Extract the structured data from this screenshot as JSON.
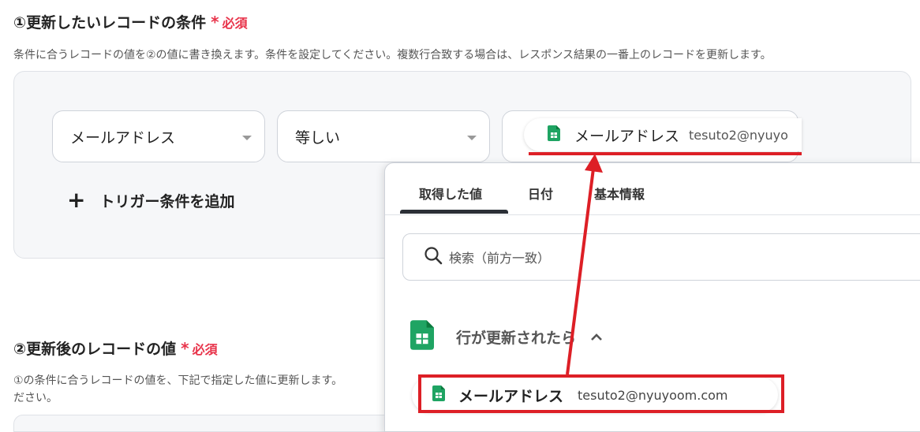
{
  "section1": {
    "title": "①更新したいレコードの条件",
    "required_label": "必須",
    "description": "条件に合うレコードの値を②の値に書き換えます。条件を設定してください。複数行合致する場合は、レスポンス結果の一番上のレコードを更新します。",
    "field_select": "メールアドレス",
    "operator_select": "等しい",
    "value_chip": {
      "label": "メールアドレス",
      "value": "tesuto2@nyuyo"
    },
    "add_condition": "トリガー条件を追加"
  },
  "section2": {
    "title": "②更新後のレコードの値",
    "required_label": "必須",
    "description_line1": "①の条件に合うレコードの値を、下記で指定した値に更新します。",
    "description_line2": "ださい。"
  },
  "dropdown": {
    "tabs": [
      "取得した値",
      "日付",
      "基本情報"
    ],
    "active_tab_index": 0,
    "search_placeholder": "検索（前方一致）",
    "group_title": "行が更新されたら",
    "item": {
      "label": "メールアドレス",
      "value": "tesuto2@nyuyoom.com"
    }
  },
  "colors": {
    "required": "#e8334a",
    "annotation_red": "#dd1f26",
    "sheets_green": "#1fa463"
  }
}
